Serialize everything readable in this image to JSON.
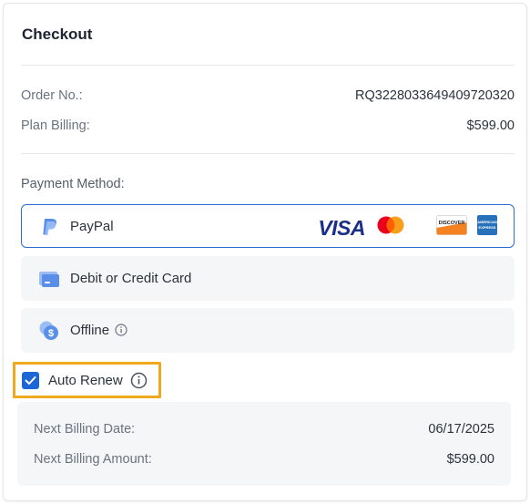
{
  "checkout": {
    "title": "Checkout",
    "order_no": {
      "label": "Order No.:",
      "value": "RQ3228033649409720320"
    },
    "plan_billing": {
      "label": "Plan Billing:",
      "value": "$599.00"
    }
  },
  "payment": {
    "label": "Payment Method:",
    "options": [
      {
        "label": "PayPal",
        "icon": "paypal-icon",
        "selected": true
      },
      {
        "label": "Debit or Credit Card",
        "icon": "credit-card-icon",
        "selected": false
      },
      {
        "label": "Offline",
        "icon": "offline-payment-icon",
        "selected": false
      }
    ],
    "card_brands": {
      "visa": "VISA",
      "discover": "DISCOVER",
      "amex": "AMERICAN EXPRESS"
    }
  },
  "auto_renew": {
    "label": "Auto Renew",
    "checked": true
  },
  "billing": {
    "next_date": {
      "label": "Next Billing Date:",
      "value": "06/17/2025"
    },
    "next_amount": {
      "label": "Next Billing Amount:",
      "value": "$599.00"
    }
  },
  "colors": {
    "accent": "#1c66d6",
    "highlight": "#f0a81c",
    "panel": "#f5f6f8"
  }
}
